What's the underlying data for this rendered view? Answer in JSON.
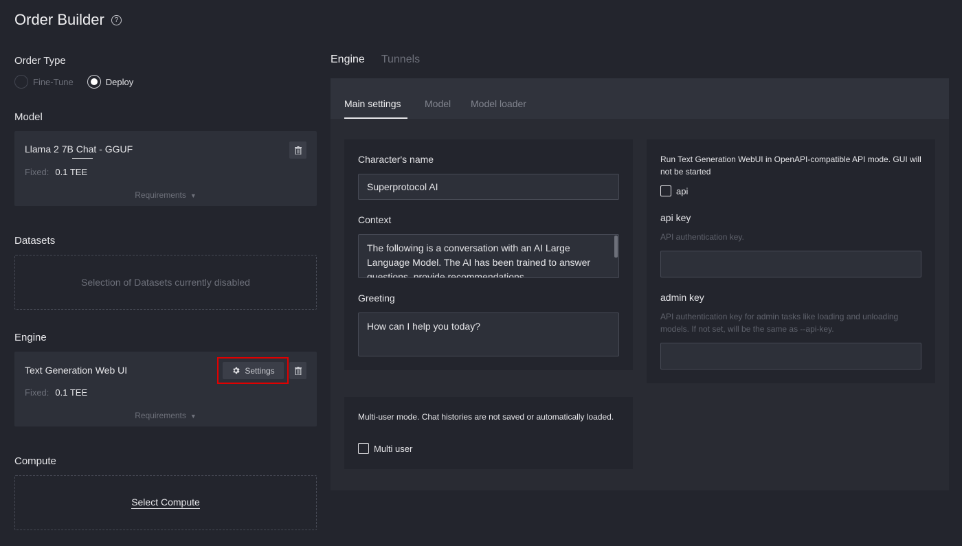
{
  "page": {
    "title": "Order Builder"
  },
  "order_type": {
    "label": "Order Type",
    "options": [
      {
        "label": "Fine-Tune",
        "state": "disabled"
      },
      {
        "label": "Deploy",
        "state": "selected"
      }
    ]
  },
  "model": {
    "label": "Model",
    "card": {
      "name": "Llama 2 7B Chat - GGUF",
      "fixed_label": "Fixed:",
      "fixed_value": "0.1 TEE",
      "requirements": "Requirements"
    }
  },
  "datasets": {
    "label": "Datasets",
    "message": "Selection of Datasets currently disabled"
  },
  "engine": {
    "label": "Engine",
    "card": {
      "name": "Text Generation Web UI",
      "settings_label": "Settings",
      "fixed_label": "Fixed:",
      "fixed_value": "0.1 TEE",
      "requirements": "Requirements"
    }
  },
  "compute": {
    "label": "Compute",
    "action": "Select Compute"
  },
  "top_tabs": [
    "Engine",
    "Tunnels"
  ],
  "sub_tabs": [
    "Main settings",
    "Model",
    "Model loader"
  ],
  "main_settings": {
    "character_name_label": "Character's name",
    "character_name_value": "Superprotocol AI",
    "context_label": "Context",
    "context_value": "The following is a conversation with an AI Large Language Model. The AI has been trained to answer questions, provide recommendations",
    "greeting_label": "Greeting",
    "greeting_value": "How can I help you today?",
    "multi_user_desc": "Multi-user mode. Chat histories are not saved or automatically loaded.",
    "multi_user_label": "Multi user",
    "api_desc": "Run Text Generation WebUI in OpenAPI-compatible API mode. GUI will not be started",
    "api_label": "api",
    "api_key_label": "api key",
    "api_key_desc": "API authentication key.",
    "api_key_value": "",
    "admin_key_label": "admin key",
    "admin_key_desc": "API authentication key for admin tasks like loading and unloading models. If not set, will be the same as --api-key.",
    "admin_key_value": ""
  },
  "colors": {
    "background": "#23252d",
    "card": "#2d3039",
    "highlight": "#e00000"
  }
}
